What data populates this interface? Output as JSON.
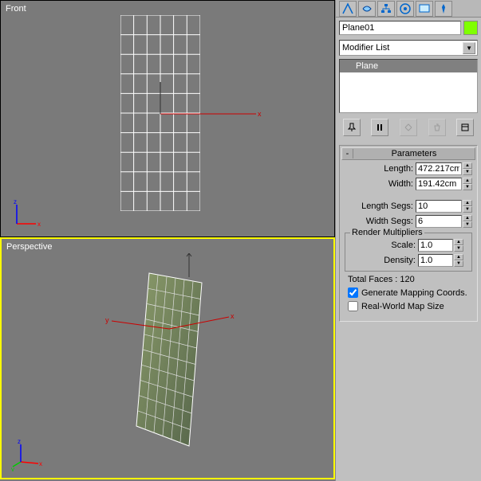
{
  "viewports": {
    "top": {
      "label": "Front"
    },
    "bottom": {
      "label": "Perspective"
    }
  },
  "object": {
    "name": "Plane01",
    "color": "#7fff00",
    "modifier_list_label": "Modifier List",
    "stack_item": "Plane"
  },
  "params": {
    "header": "Parameters",
    "length_label": "Length:",
    "length_value": "472.217cm",
    "width_label": "Width:",
    "width_value": "191.42cm",
    "length_segs_label": "Length Segs:",
    "length_segs_value": "10",
    "width_segs_label": "Width Segs:",
    "width_segs_value": "6",
    "render_mult_label": "Render Multipliers",
    "scale_label": "Scale:",
    "scale_value": "1.0",
    "density_label": "Density:",
    "density_value": "1.0",
    "total_faces": "Total Faces : 120",
    "gen_mapping": "Generate Mapping Coords.",
    "real_world": "Real-World Map Size"
  }
}
